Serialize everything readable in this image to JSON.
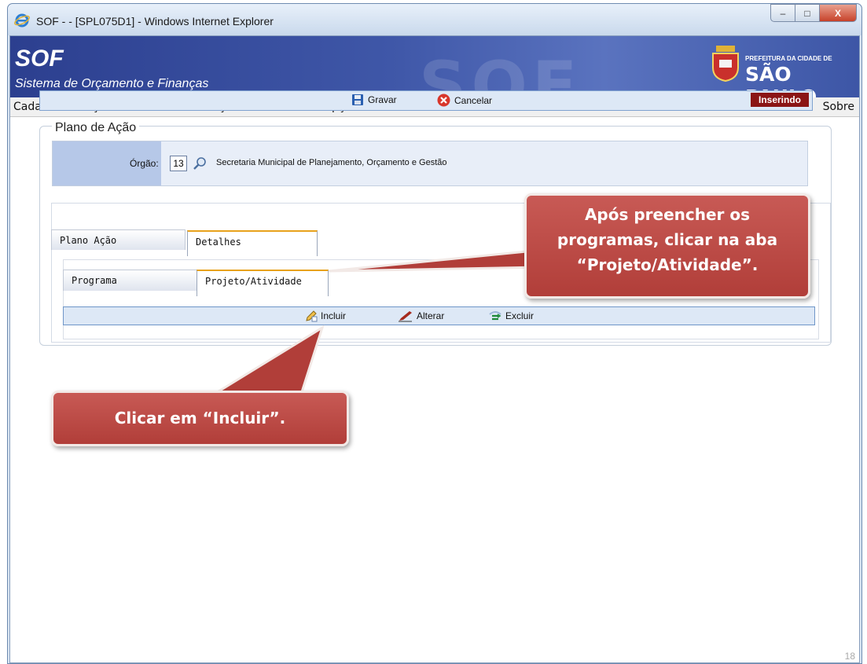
{
  "window": {
    "title": "SOF - - [SPL075D1] - Windows Internet Explorer",
    "controls": {
      "minimize": "–",
      "maximize": "□",
      "close": "X"
    }
  },
  "banner": {
    "logo": "SOF",
    "subtitle": "Sistema de Orçamento e Finanças",
    "pref_small": "PREFEITURA DA CIDADE DE",
    "pref_big": "SÃO PAULO",
    "decor_text": "SOF"
  },
  "menu": {
    "items": [
      "Cadastro",
      "Orçamento",
      "Administração",
      "Relatório",
      "Opções"
    ],
    "about": "Sobre"
  },
  "toolbar": {
    "save_label": "Gravar",
    "cancel_label": "Cancelar",
    "status": "Inserindo"
  },
  "form": {
    "legend": "Plano de Ação",
    "org_label": "Órgão:",
    "org_code": "13",
    "org_name": "Secretaria Municipal de Planejamento, Orçamento e Gestão"
  },
  "tabs": {
    "outer": [
      "Plano Ação",
      "Detalhes"
    ],
    "inner": [
      "Programa",
      "Projeto/Atividade"
    ]
  },
  "actions": {
    "include": "Incluir",
    "alter": "Alterar",
    "delete": "Excluir"
  },
  "callouts": {
    "first": [
      "Após preencher os",
      "programas, clicar na aba",
      "“Projeto/Atividade”."
    ],
    "second": "Clicar em “Incluir”."
  },
  "page_number": "18",
  "colors": {
    "banner": "#3f57a8",
    "status_badge": "#8b1515",
    "callout": "#b13e39",
    "active_tab_accent": "#e8a21c"
  }
}
